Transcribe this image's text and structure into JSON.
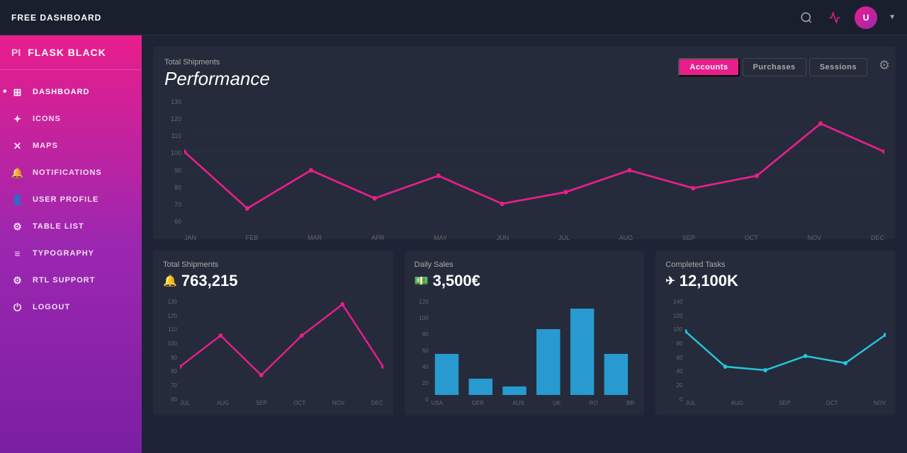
{
  "topbar": {
    "title": "FREE DASHBOARD"
  },
  "sidebar": {
    "brand_pi": "PI",
    "brand_name": "FLASK BLACK",
    "items": [
      {
        "id": "dashboard",
        "label": "DASHBOARD",
        "icon": "⊞",
        "active": true
      },
      {
        "id": "icons",
        "label": "ICONS",
        "icon": "✦"
      },
      {
        "id": "maps",
        "label": "MAPS",
        "icon": "✕"
      },
      {
        "id": "notifications",
        "label": "NOTIFICATIONS",
        "icon": "🔔"
      },
      {
        "id": "user-profile",
        "label": "USER PROFILE",
        "icon": "👤"
      },
      {
        "id": "table-list",
        "label": "TABLE LIST",
        "icon": "⚙"
      },
      {
        "id": "typography",
        "label": "TYPOGRAPHY",
        "icon": "≡"
      },
      {
        "id": "rtl-support",
        "label": "RTL SUPPORT",
        "icon": "⚙"
      },
      {
        "id": "logout",
        "label": "LOGOUT",
        "icon": "⏻"
      }
    ]
  },
  "performance": {
    "subtitle": "Total Shipments",
    "title": "Performance",
    "tabs": [
      "Accounts",
      "Purchases",
      "Sessions"
    ],
    "active_tab": "Accounts",
    "y_labels": [
      "130",
      "120",
      "110",
      "100",
      "90",
      "80",
      "70",
      "60"
    ],
    "x_labels": [
      "JAN",
      "FEB",
      "MAR",
      "APR",
      "MAY",
      "JUN",
      "JUL",
      "AUG",
      "SEP",
      "OCT",
      "NOV",
      "DEC"
    ],
    "data_points": [
      100,
      70,
      90,
      75,
      88,
      72,
      78,
      90,
      80,
      88,
      115,
      100
    ]
  },
  "card1": {
    "subtitle": "Total Shipments",
    "value": "763,215",
    "icon": "🔔",
    "y_labels": [
      "130",
      "120",
      "110",
      "100",
      "90",
      "80",
      "70",
      "60"
    ],
    "x_labels": [
      "JUL",
      "AUG",
      "SEP",
      "OCT",
      "NOV",
      "DEC"
    ],
    "data_points": [
      80,
      100,
      70,
      100,
      120,
      80
    ]
  },
  "card2": {
    "subtitle": "Daily Sales",
    "value": "3,500€",
    "icon": "💵",
    "y_labels": [
      "120",
      "100",
      "80",
      "60",
      "40",
      "20",
      "0"
    ],
    "x_labels": [
      "USA",
      "GER",
      "AUS",
      "UK",
      "RO",
      "BR"
    ],
    "bar_values": [
      50,
      20,
      10,
      80,
      105,
      50
    ]
  },
  "card3": {
    "subtitle": "Completed Tasks",
    "value": "12,100K",
    "icon": "✈",
    "y_labels": [
      "140",
      "120",
      "100",
      "80",
      "60",
      "40",
      "20",
      "0"
    ],
    "x_labels": [
      "JUL",
      "AUG",
      "SEP",
      "OCT",
      "NOV"
    ],
    "data_points": [
      90,
      40,
      35,
      65,
      50,
      85
    ]
  }
}
